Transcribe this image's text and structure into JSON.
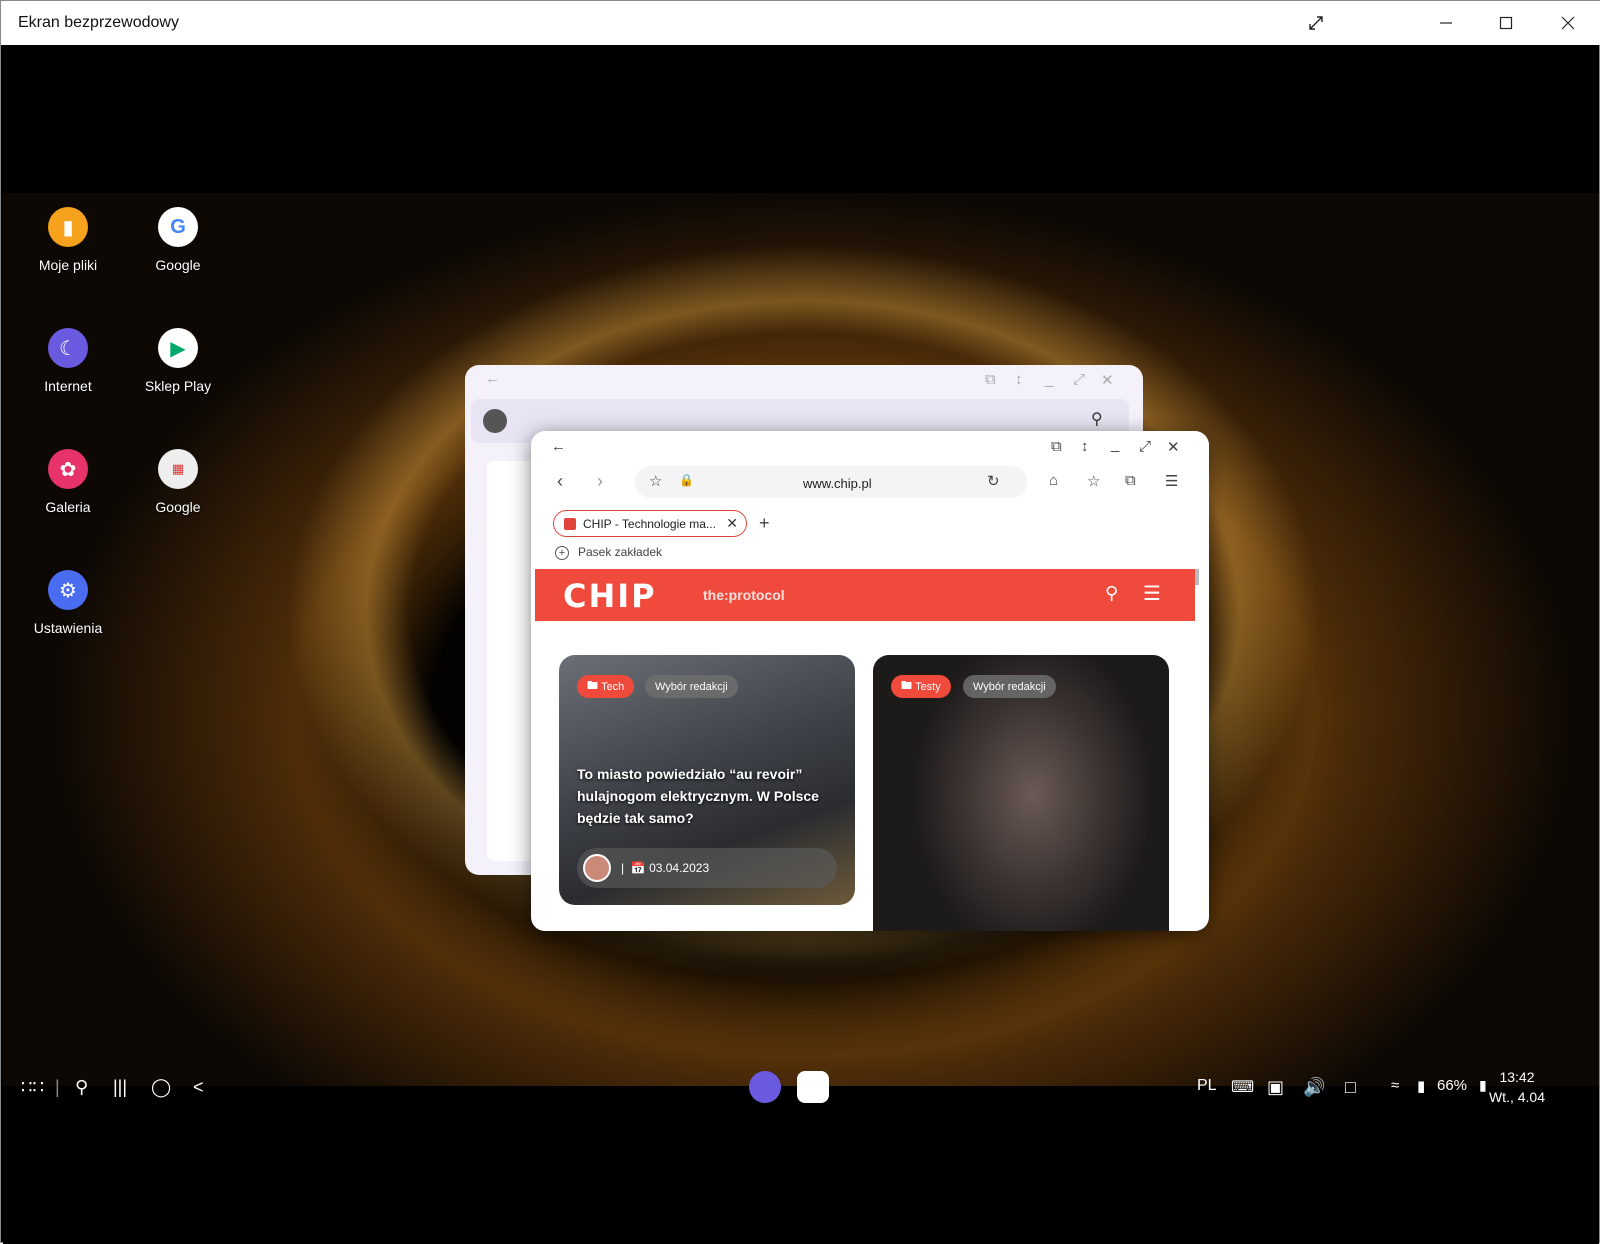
{
  "window": {
    "title": "Ekran bezprzewodowy"
  },
  "desktop_apps": [
    {
      "label": "Moje pliki",
      "icon": "folder-icon",
      "color": "#f7a21c"
    },
    {
      "label": "Google",
      "icon": "google-icon",
      "color": "#ffffff"
    },
    {
      "label": "Internet",
      "icon": "samsung-internet-icon",
      "color": "#6a5ae0"
    },
    {
      "label": "Sklep Play",
      "icon": "play-store-icon",
      "color": "#ffffff"
    },
    {
      "label": "Galeria",
      "icon": "gallery-icon",
      "color": "#e8336a"
    },
    {
      "label": "Google",
      "icon": "google-apps-folder-icon",
      "color": "#ffffff"
    },
    {
      "label": "Ustawienia",
      "icon": "settings-icon",
      "color": "#4a6cf0"
    }
  ],
  "browser": {
    "url": "www.chip.pl",
    "tab_title": "CHIP - Technologie ma...",
    "bookmarks_label": "Pasek zakładek",
    "site": {
      "logo": "CHIP",
      "partner": "the:protocol",
      "cards": [
        {
          "tags": [
            "Tech",
            "Wybór redakcji"
          ],
          "headline": "To miasto powiedziało “au revoir” hulajnogom elektrycznym. W Polsce będzie tak samo?",
          "date": "03.04.2023"
        },
        {
          "tags": [
            "Testy",
            "Wybór redakcji"
          ]
        }
      ]
    }
  },
  "taskbar": {
    "language": "PL",
    "battery": "66%",
    "time": "13:42",
    "date": "Wt., 4.04"
  },
  "colors": {
    "chip_red": "#ef4a3b",
    "accent_orange": "#d9901e"
  }
}
